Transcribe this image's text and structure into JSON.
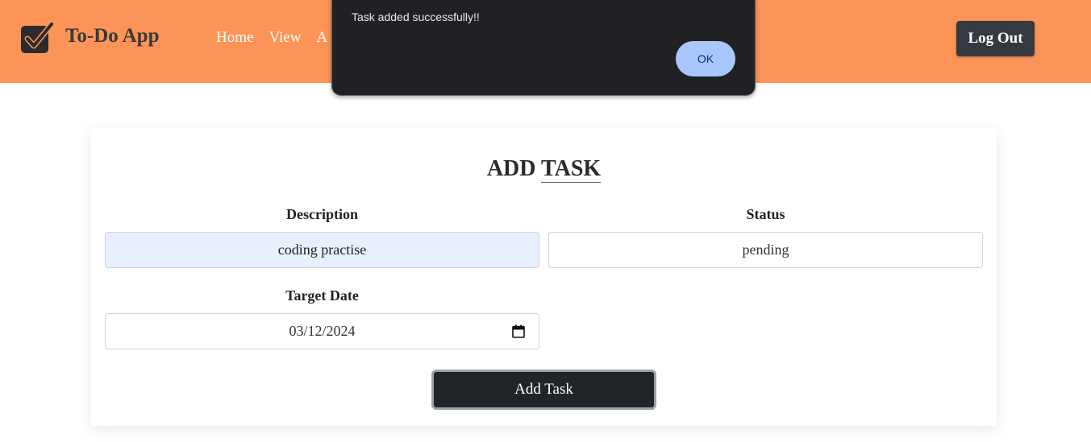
{
  "navbar": {
    "brand": "To-Do App",
    "links": [
      "Home",
      "View",
      "A"
    ],
    "logout_label": "Log Out",
    "background": "#fd9457"
  },
  "alert": {
    "message": "Task added successfully!!",
    "ok_label": "OK"
  },
  "form": {
    "title_part1": "ADD",
    "title_part2": "TASK",
    "description_label": "Description",
    "description_value": "coding practise",
    "status_label": "Status",
    "status_value": "pending",
    "target_date_label": "Target Date",
    "target_date_value": "03/12/2024",
    "submit_label": "Add Task"
  },
  "icons": {
    "logo": "checkbox-check-icon",
    "date": "calendar-icon"
  }
}
